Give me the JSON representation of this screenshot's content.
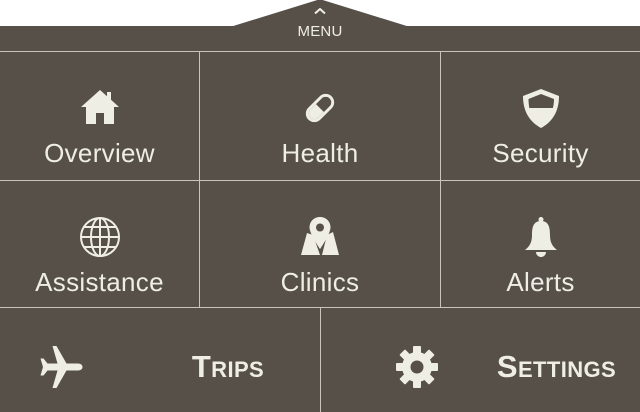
{
  "menu": {
    "label": "MENU"
  },
  "tiles": {
    "overview": "Overview",
    "health": "Health",
    "security": "Security",
    "assistance": "Assistance",
    "clinics": "Clinics",
    "alerts": "Alerts"
  },
  "actions": {
    "trips": "Trips",
    "settings": "Settings"
  },
  "icons": {
    "overview": "house-icon",
    "health": "pill-icon",
    "security": "shield-icon",
    "assistance": "globe-icon",
    "clinics": "map-pin-icon",
    "alerts": "bell-icon",
    "trips": "airplane-icon",
    "settings": "gear-icon",
    "menu": "chevron-up-icon"
  },
  "colors": {
    "panel": "#565049",
    "divider": "#c9c4bc",
    "text": "#efeee4"
  }
}
